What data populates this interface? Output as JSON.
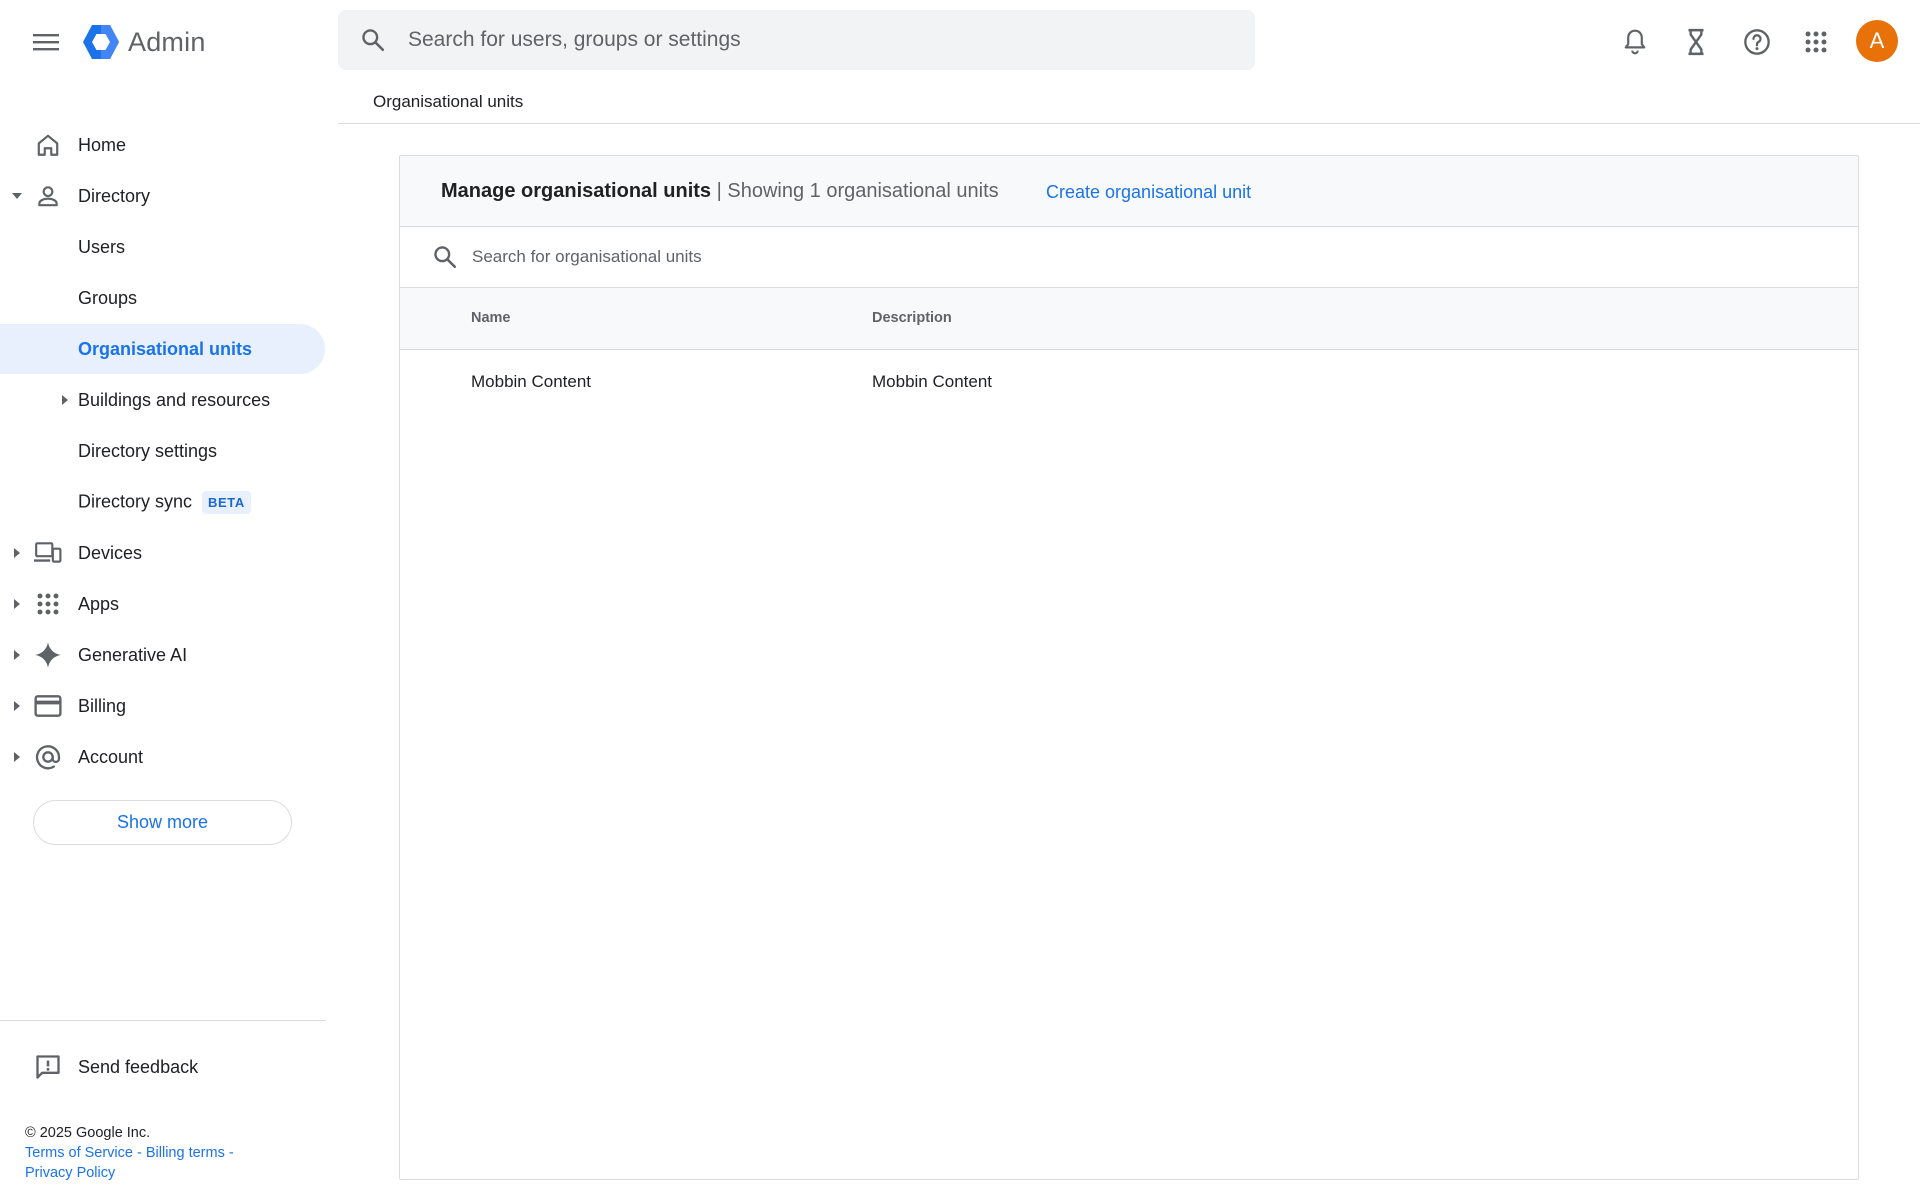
{
  "app": {
    "title": "Admin"
  },
  "search": {
    "placeholder": "Search for users, groups or settings"
  },
  "user": {
    "avatar_letter": "A",
    "avatar_color": "#e8710a"
  },
  "breadcrumb": "Organisational units",
  "sidebar": {
    "items": [
      {
        "label": "Home",
        "icon": "home-icon"
      },
      {
        "label": "Directory",
        "icon": "person-icon",
        "expanded": true
      },
      {
        "label": "Users"
      },
      {
        "label": "Groups"
      },
      {
        "label": "Organisational units",
        "active": true
      },
      {
        "label": "Buildings and resources"
      },
      {
        "label": "Directory settings"
      },
      {
        "label": "Directory sync",
        "badge": "BETA"
      },
      {
        "label": "Devices",
        "icon": "devices-icon"
      },
      {
        "label": "Apps",
        "icon": "apps-icon"
      },
      {
        "label": "Generative AI",
        "icon": "sparkle-icon"
      },
      {
        "label": "Billing",
        "icon": "credit-card-icon"
      },
      {
        "label": "Account",
        "icon": "at-sign-icon"
      }
    ],
    "show_more": "Show more",
    "feedback": "Send feedback"
  },
  "footer": {
    "copyright": "© 2025 Google Inc.",
    "terms": "Terms of Service",
    "billing_terms": "Billing terms",
    "privacy": "Privacy Policy"
  },
  "main": {
    "title": "Manage organisational units",
    "subtitle": "| Showing 1 organisational units",
    "create_link": "Create organisational unit",
    "search_placeholder": "Search for organisational units",
    "columns": [
      "Name",
      "Description"
    ],
    "rows": [
      {
        "name": "Mobbin Content",
        "description": "Mobbin Content"
      }
    ]
  },
  "colors": {
    "accent": "#1a73e8",
    "active_bg": "#e8f0fe",
    "avatar": "#e8710a"
  }
}
